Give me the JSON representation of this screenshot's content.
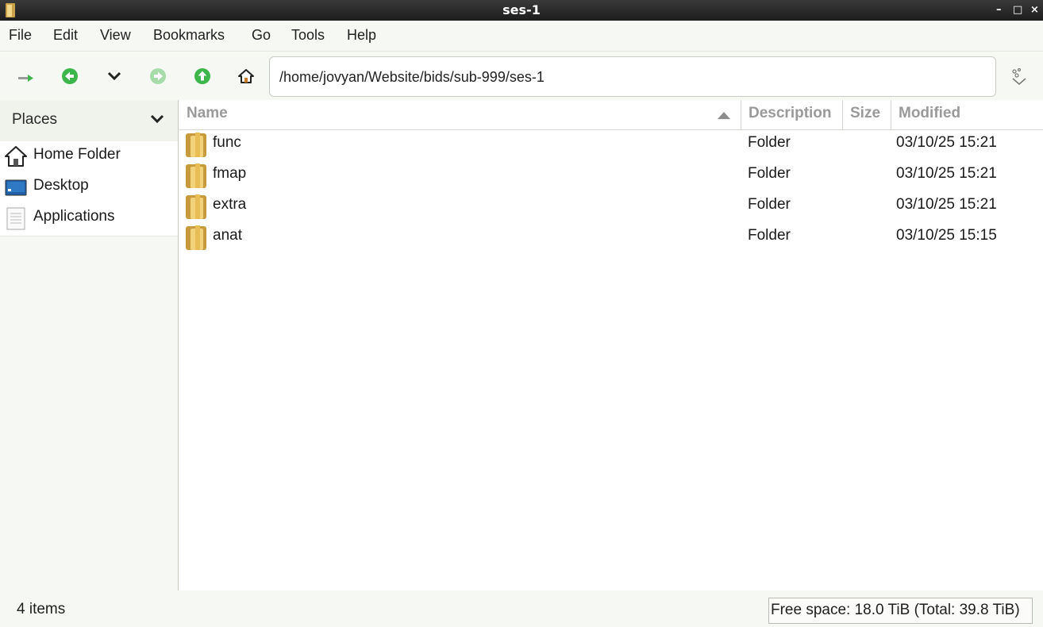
{
  "window": {
    "title": "ses-1",
    "controls": [
      "–",
      "□",
      "×"
    ]
  },
  "menu": [
    "File",
    "Edit",
    "View",
    "Bookmarks",
    "Go",
    "Tools",
    "Help"
  ],
  "toolbar": {
    "location": "/home/jovyan/Website/bids/sub-999/ses-1",
    "icons": [
      "new-tab-icon",
      "back-icon",
      "history-dropdown-icon",
      "forward-icon",
      "up-icon",
      "home-icon",
      "location-toggle-icon"
    ],
    "colors": {
      "nav_green": "#3cb54a",
      "disabled_green": "#a6dcaa"
    }
  },
  "sidebar": {
    "header": "Places",
    "items": [
      {
        "label": "Home Folder",
        "icon": "home-icon"
      },
      {
        "label": "Desktop",
        "icon": "desktop-icon"
      },
      {
        "label": "Applications",
        "icon": "applications-icon"
      }
    ]
  },
  "columns": [
    "Name",
    "Description",
    "Size",
    "Modified"
  ],
  "files": [
    {
      "name": "func",
      "description": "Folder",
      "size": "",
      "modified": "03/10/25 15:21"
    },
    {
      "name": "fmap",
      "description": "Folder",
      "size": "",
      "modified": "03/10/25 15:21"
    },
    {
      "name": "extra",
      "description": "Folder",
      "size": "",
      "modified": "03/10/25 15:21"
    },
    {
      "name": "anat",
      "description": "Folder",
      "size": "",
      "modified": "03/10/25 15:15"
    }
  ],
  "status": {
    "count": "4 items",
    "free_space": "Free space: 18.0 TiB (Total: 39.8 TiB)"
  }
}
